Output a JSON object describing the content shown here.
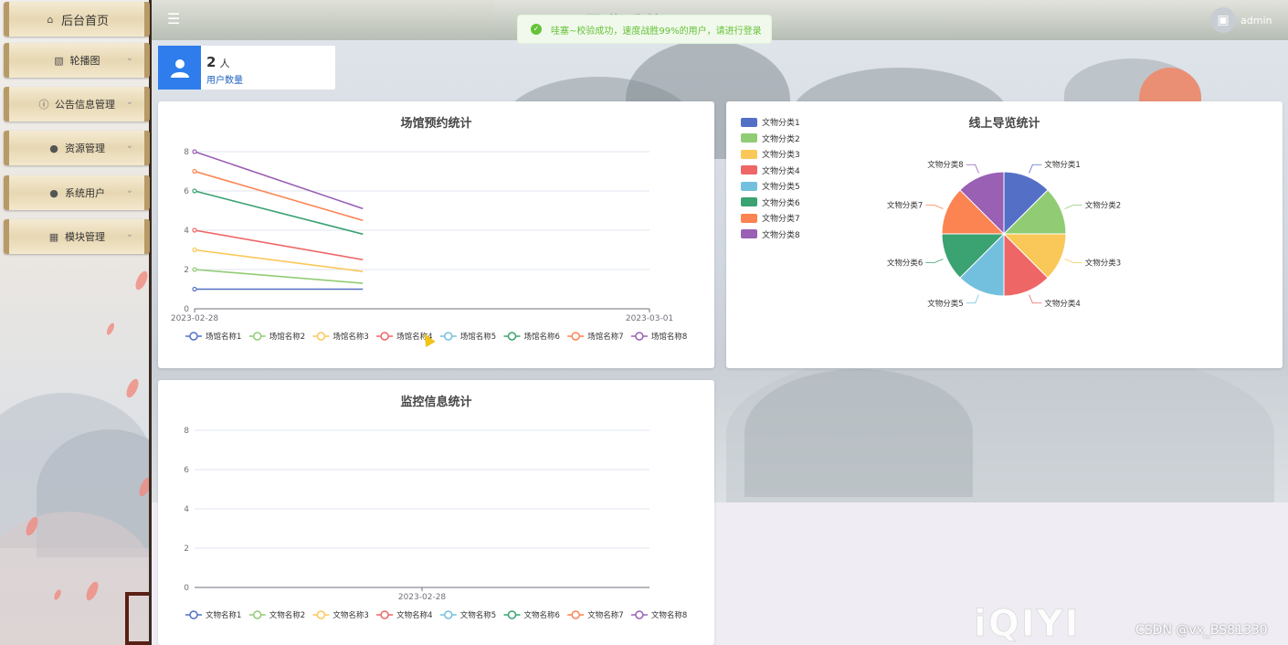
{
  "header": {
    "system_title": "导览系统",
    "user_name": "admin",
    "avatar_icon": "image-icon",
    "menu_icon": "hamburger-icon"
  },
  "toast": {
    "message": "哇塞~校验成功，速度战胜99%的用户，请进行登录",
    "icon": "check-circle-icon",
    "color": "#67c23a"
  },
  "sidebar": {
    "items": [
      {
        "label": "后台首页",
        "icon": "home-icon"
      },
      {
        "label": "轮播图",
        "icon": "picture-icon"
      },
      {
        "label": "公告信息管理",
        "icon": "info-icon"
      },
      {
        "label": "资源管理",
        "icon": "pin-icon"
      },
      {
        "label": "系统用户",
        "icon": "user-icon"
      },
      {
        "label": "模块管理",
        "icon": "grid-icon"
      }
    ]
  },
  "stat_card": {
    "value": "2",
    "unit": "人",
    "label": "用户数量",
    "icon": "user-icon",
    "color": "#2f7dec"
  },
  "watermarks": {
    "iqiyi": "iQIYI",
    "csdn": "CSDN @vx_BS81330"
  },
  "chart_data": [
    {
      "type": "line",
      "title": "场馆预约统计",
      "x": [
        "2023-02-28",
        "2023-03-01"
      ],
      "ylim": [
        0,
        8
      ],
      "yticks": [
        0,
        2,
        4,
        6,
        8
      ],
      "grid": true,
      "legend_position": "bottom",
      "series": [
        {
          "name": "场馆名称1",
          "color": "#5470c6",
          "values": [
            1,
            1
          ]
        },
        {
          "name": "场馆名称2",
          "color": "#91cc75",
          "values": [
            2,
            1.3
          ]
        },
        {
          "name": "场馆名称3",
          "color": "#fac858",
          "values": [
            3,
            1.9
          ]
        },
        {
          "name": "场馆名称4",
          "color": "#ee6666",
          "values": [
            4,
            2.5
          ]
        },
        {
          "name": "场馆名称5",
          "color": "#73c0de",
          "values": [
            null,
            null
          ]
        },
        {
          "name": "场馆名称6",
          "color": "#3ba272",
          "values": [
            6,
            3.8
          ]
        },
        {
          "name": "场馆名称7",
          "color": "#fc8452",
          "values": [
            7,
            4.5
          ]
        },
        {
          "name": "场馆名称8",
          "color": "#9a60b4",
          "values": [
            8,
            5.1
          ]
        }
      ]
    },
    {
      "type": "pie",
      "title": "线上导览统计",
      "legend_position": "top-left",
      "categories": [
        "文物分类1",
        "文物分类2",
        "文物分类3",
        "文物分类4",
        "文物分类5",
        "文物分类6",
        "文物分类7",
        "文物分类8"
      ],
      "values": [
        1,
        1,
        1,
        1,
        1,
        1,
        1,
        1
      ],
      "colors": [
        "#5470c6",
        "#91cc75",
        "#fac858",
        "#ee6666",
        "#73c0de",
        "#3ba272",
        "#fc8452",
        "#9a60b4"
      ]
    },
    {
      "type": "line",
      "title": "监控信息统计",
      "x": [
        "2023-02-28"
      ],
      "ylim": [
        0,
        8
      ],
      "yticks": [
        0,
        2,
        4,
        6,
        8
      ],
      "grid": true,
      "legend_position": "bottom",
      "series": [
        {
          "name": "文物名称1",
          "color": "#5470c6",
          "values": []
        },
        {
          "name": "文物名称2",
          "color": "#91cc75",
          "values": []
        },
        {
          "name": "文物名称3",
          "color": "#fac858",
          "values": []
        },
        {
          "name": "文物名称4",
          "color": "#ee6666",
          "values": []
        },
        {
          "name": "文物名称5",
          "color": "#73c0de",
          "values": []
        },
        {
          "name": "文物名称6",
          "color": "#3ba272",
          "values": []
        },
        {
          "name": "文物名称7",
          "color": "#fc8452",
          "values": []
        },
        {
          "name": "文物名称8",
          "color": "#9a60b4",
          "values": []
        }
      ]
    }
  ]
}
